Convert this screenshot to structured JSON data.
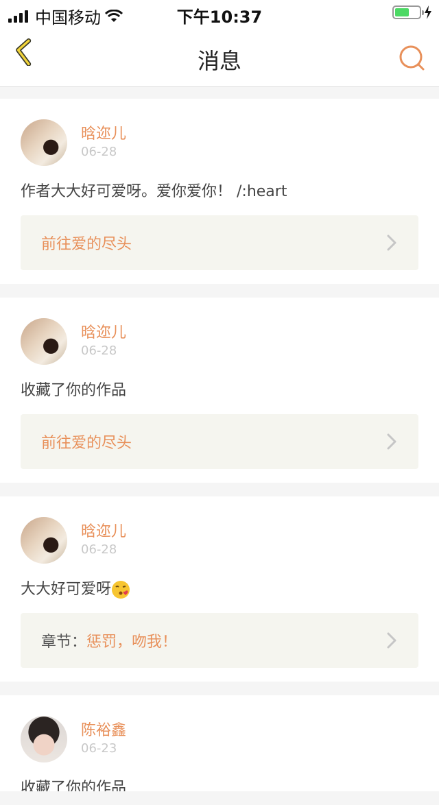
{
  "status": {
    "carrier": "中国移动",
    "time": "下午10:37"
  },
  "nav": {
    "title": "消息",
    "back_icon": "back-chevron-icon",
    "search_icon": "search-icon"
  },
  "messages": [
    {
      "user": "晗迩儿",
      "date": "06-28",
      "content": "作者大大好可爱呀。爱你爱你！ /:heart",
      "link": {
        "text": "前往爱的尽头"
      }
    },
    {
      "user": "晗迩儿",
      "date": "06-28",
      "content": "收藏了你的作品",
      "link": {
        "text": "前往爱的尽头"
      }
    },
    {
      "user": "晗迩儿",
      "date": "06-28",
      "content": "大大好可爱呀",
      "link": {
        "label": "章节：",
        "text": "惩罚，吻我！"
      }
    },
    {
      "user": "陈裕鑫",
      "date": "06-23",
      "content": "收藏了你的作品"
    }
  ],
  "colors": {
    "accent": "#e8905a",
    "link_bg": "#f5f5ef",
    "back_icon": "#f2d43a"
  }
}
